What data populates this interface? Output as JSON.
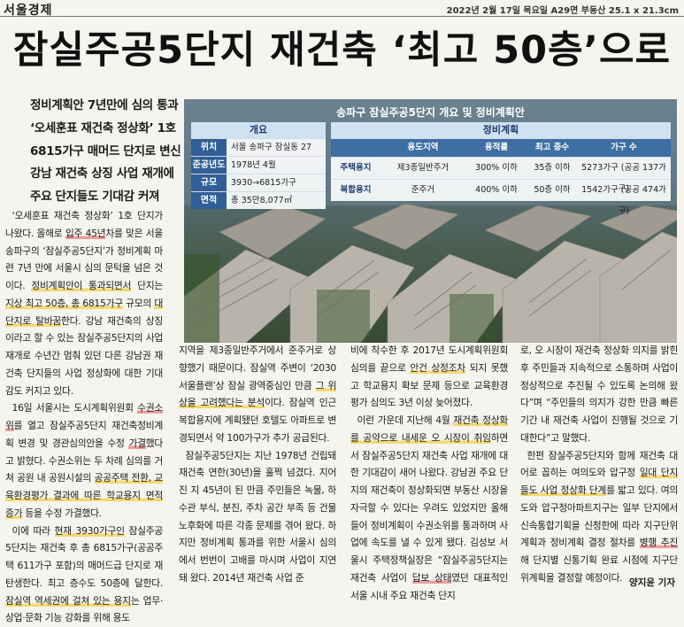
{
  "masthead": {
    "publication": "서울경제",
    "dateline": "2022년 2월 17일 목요일 A29면 부동산 25.1 x 21.3cm"
  },
  "headline": "잠실주공5단지 재건축 ‘최고 50층’으로",
  "subheads": [
    "정비계획안 7년만에 심의 통과",
    "‘오세훈표 재건축 정상화’ 1호",
    "6815가구 매머드 단지로 변신",
    "강남 재건축 상징 사업 재개에",
    "주요 단지들도 기대감 커져"
  ],
  "infographic": {
    "title": "송파구 잠실주공5단지 개요 및 정비계획안",
    "overview": {
      "header": "개요",
      "rows": [
        {
          "label": "위치",
          "value": "서울 송파구 잠실동 27"
        },
        {
          "label": "준공년도",
          "value": "1978년 4월"
        },
        {
          "label": "규모",
          "value": "3930→6815가구"
        },
        {
          "label": "면적",
          "value": "총 35만8,077㎡"
        }
      ]
    },
    "plan": {
      "header": "정비계획",
      "columns": [
        "",
        "용도지역",
        "용적률",
        "최고 층수",
        "가구 수"
      ],
      "rows": [
        [
          "주택용지",
          "제3종일반주거",
          "300% 이하",
          "35층 이하",
          "5273가구 (공공 137가구)"
        ],
        [
          "복합용지",
          "준주거",
          "400% 이하",
          "50층 이하",
          "1542가구 (공공 474가구)"
        ]
      ]
    }
  },
  "columns": [
    [
      [
        {
          "t": "‘오세훈표 재건축 정상화’ 1호 단지가 나왔다. 올해로 "
        },
        {
          "t": "입주 45년",
          "h": "r"
        },
        {
          "t": "차를 맞은 서울 송파구의 ‘잠실주공5단지’가 정비계획 마련 7년 만에 서울시 심의 문턱을 넘은 것이다. "
        },
        {
          "t": "정비계획안이 통과되면서",
          "h": "y"
        },
        {
          "t": " 단지는 "
        },
        {
          "t": "지상 최고 50층, 총 6815가구",
          "h": "y"
        },
        {
          "t": " 규모의 "
        },
        {
          "t": "대단지로 탈바꿈",
          "h": "y"
        },
        {
          "t": "한다. 강남 재건축의 상징이라고 할 수 있는 잠실주공5단지의 사업 재개로 수년간 멈춰 있던 다른 강남권 재건축 단지들의 사업 정상화에 대한 기대감도 커지고 있다."
        }
      ],
      [
        {
          "t": "16일 서울시는 도시계획위원회 "
        },
        {
          "t": "수권소위",
          "h": "r"
        },
        {
          "t": "를 열고 잠실주공5단지 재건축정비계획 변경 및 경관심의안을 수정 "
        },
        {
          "t": "가결",
          "h": "r"
        },
        {
          "t": "했다고 밝혔다. 수권소위는 두 차례 심의를 거쳐 공원 내 공원시설의 "
        },
        {
          "t": "공공주택 전환, 교육환경평가 결과에 따른 학교용지 면적 증가",
          "h": "y"
        },
        {
          "t": " 등을 수정 가결했다."
        }
      ],
      [
        {
          "t": "이에 따라 "
        },
        {
          "t": "현재 3930가구인",
          "h": "y"
        },
        {
          "t": " 잠실주공5단지는 재건축 후 총 6815가구(공공주택 611가구 포함)의 매머드급 단지로 재탄생한다. 최고 층수도 50층에 달한다. "
        },
        {
          "t": "잠실역 역세권에 걸쳐 있는 용지",
          "h": "y"
        },
        {
          "t": "는 업무·상업·문화 기능 강화를 위해 용도"
        }
      ]
    ],
    [
      [
        {
          "t": "지역을 제3종일반주거에서 준주거로 상향했기 때문이다. 잠실역 주변이 ‘2030 서울플랜’상 잠실 광역중심인 만큼 "
        },
        {
          "t": "그 위상을 고려했다는 분석",
          "h": "y"
        },
        {
          "t": "이다. 잠실역 인근 복합용지에 계획됐던 호텔도 아파트로 변경되면서 약 100가구가 추가 공급된다."
        }
      ],
      [
        {
          "t": "잠실주공5단지는 지난 1978년 건립돼 재건축 연한(30년)을 훌쩍 넘겼다. 지어진 지 45년이 된 만큼 주민들은 녹물, 하수관 부식, 분진, 주차 공간 부족 등 건물 노후화에 따른 각종 문제를 겪어 왔다. 하지만 정비계획 통과를 위한 서울시 심의에서 번번이 고배를 마시며 사업이 지연돼 왔다. 2014년 재건축 사업 준"
        }
      ]
    ],
    [
      [
        {
          "t": "비에 착수한 후 2017년 도시계획위원회 심의를 끝으로 "
        },
        {
          "t": "안건 상정조차",
          "h": "y"
        },
        {
          "t": " 되지 못했고 학교용지 확보 문제 등으로 교육환경평가 심의도 3년 이상 늦어졌다."
        }
      ],
      [
        {
          "t": "이런 가운데 지난해 4월 "
        },
        {
          "t": "재건축 정상화를 공약으로 내세운 오 시장이 취임",
          "h": "y"
        },
        {
          "t": "하면서 잠실주공5단지 재건축 사업 재개에 대한 기대감이 새어 나왔다. 강남권 주요 단지의 재건축이 정상화되면 부동산 시장을 자극할 수 있다는 우려도 있었지만 올해 들어 정비계획이 수권소위를 통과하며 사업에 속도를 낼 수 있게 됐다. 김성보 서울시 주택정책실장은 “잠실주공5단지는 재건축 사업이 "
        },
        {
          "t": "답보 상태",
          "h": "r"
        },
        {
          "t": "였던 대표적인 서울 시내 주요 재건축 단지"
        }
      ]
    ],
    [
      [
        {
          "t": "로, 오 시장이 재건축 정상화 의지를 밝힌 후 주민들과 지속적으로 소통하며 사업이 정상적으로 추진될 수 있도록 논의해 왔다”며 “주민들의 의지가 강한 만큼 빠른 기간 내 재건축 사업이 진행될 것으로 기대한다”고 말했다."
        }
      ],
      [
        {
          "t": "한편 잠실주공5단지와 함께 재건축 대어로 꼽히는 여의도와 압구정 "
        },
        {
          "t": "일대 단지들도 사업 정상화 단계",
          "h": "y"
        },
        {
          "t": "를 밟고 있다. 여의도와 압구정아파트지구는 일부 단지에서 신속통합기획을 신청한에 따라 지구단위계획과 정비계획 결정 절차를 "
        },
        {
          "t": "병행 추진",
          "h": "r"
        },
        {
          "t": "해 단지별 신통기획 완료 시점에 지구단위계획을 결정할 예정이다."
        }
      ]
    ]
  ],
  "byline": "양지윤 기자"
}
